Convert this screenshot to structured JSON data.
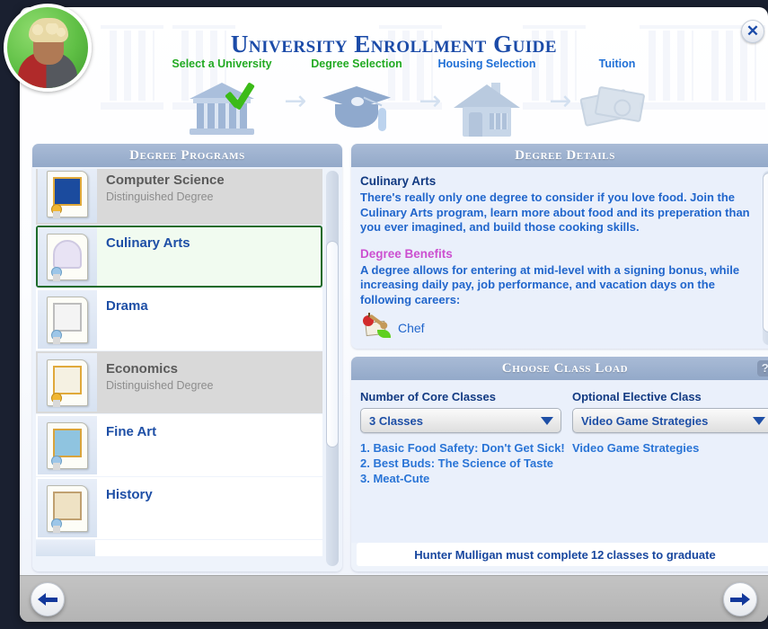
{
  "window": {
    "title": "University Enrollment Guide",
    "close_label": "✕",
    "avatar_name": "sim-avatar"
  },
  "steps": [
    {
      "label": "Select a University",
      "state": "done",
      "icon": "bank-icon",
      "checked": true
    },
    {
      "label": "Degree Selection",
      "state": "done",
      "icon": "graduation-cap-icon",
      "checked": false
    },
    {
      "label": "Housing Selection",
      "state": "todo",
      "icon": "house-icon",
      "checked": false
    },
    {
      "label": "Tuition",
      "state": "todo",
      "icon": "money-icon",
      "checked": false
    }
  ],
  "step_arrow": "→",
  "colors": {
    "step_done": "#22aa22",
    "step_todo": "#1f6fd6",
    "title": "#1b4ba8",
    "selection_border": "#1d6b2a",
    "benefits_heading": "#cc4fd0"
  },
  "degree_programs": {
    "header": "Degree Programs",
    "items": [
      {
        "name": "Computer Science",
        "subtitle": "Distinguished Degree",
        "locked": true,
        "selected": false,
        "seal": "gold"
      },
      {
        "name": "Culinary Arts",
        "subtitle": "",
        "locked": false,
        "selected": true,
        "seal": "blue"
      },
      {
        "name": "Drama",
        "subtitle": "",
        "locked": false,
        "selected": false,
        "seal": "blue"
      },
      {
        "name": "Economics",
        "subtitle": "Distinguished Degree",
        "locked": true,
        "selected": false,
        "seal": "gold"
      },
      {
        "name": "Fine Art",
        "subtitle": "",
        "locked": false,
        "selected": false,
        "seal": "blue"
      },
      {
        "name": "History",
        "subtitle": "",
        "locked": false,
        "selected": false,
        "seal": "blue"
      }
    ]
  },
  "degree_details": {
    "header": "Degree Details",
    "title": "Culinary Arts",
    "description": "There's really only one degree to consider if you love food. Join the Culinary Arts program, learn more about food and its preperation than you ever imagined, and build those cooking skills.",
    "benefits_heading": "Degree Benefits",
    "benefits_text": "A degree allows for entering at mid-level with a signing bonus, while increasing daily pay, job performance, and vacation days on the following careers:",
    "careers": [
      {
        "name": "Chef",
        "icon": "chef-icon"
      }
    ]
  },
  "class_load": {
    "header": "Choose Class Load",
    "help_label": "?",
    "core": {
      "label": "Number of Core Classes",
      "value": "3 Classes",
      "classes": [
        "1.  Basic Food Safety: Don't Get Sick!",
        "2.  Best Buds: The Science of Taste",
        "3.  Meat-Cute"
      ]
    },
    "elective": {
      "label": "Optional Elective Class",
      "value": "Video Game Strategies",
      "classes": [
        "Video Game Strategies"
      ]
    },
    "graduation_note_prefix": "Hunter Mulligan must complete",
    "graduation_note_count": "12",
    "graduation_note_suffix": "classes to graduate"
  },
  "footer": {
    "back_label": "back-arrow",
    "next_label": "next-arrow"
  }
}
